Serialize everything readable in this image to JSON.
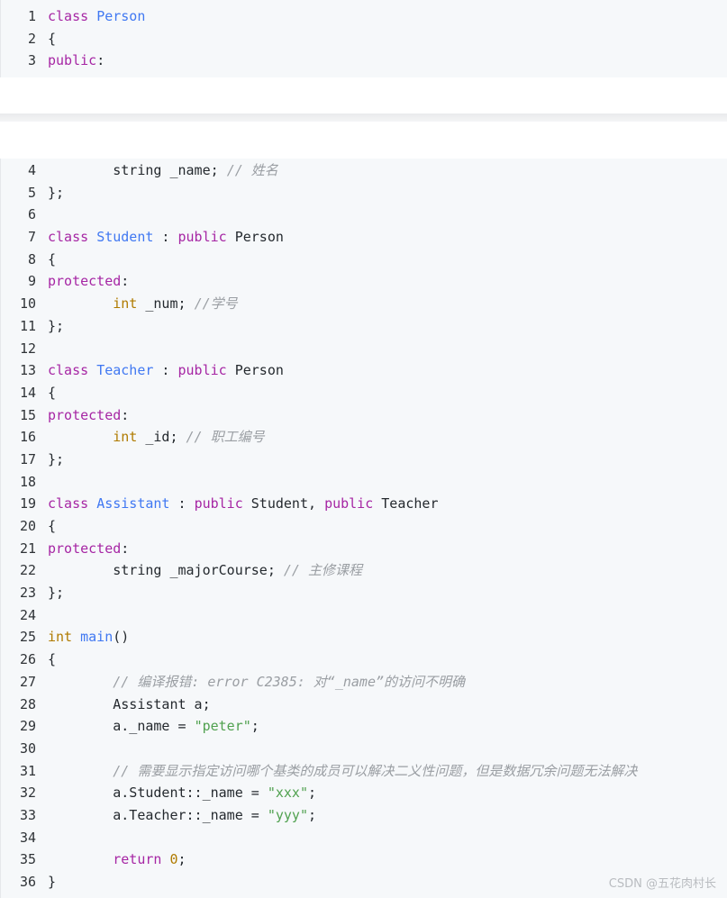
{
  "code_top": [
    {
      "n": "1",
      "tokens": [
        {
          "t": "class",
          "c": "kw"
        },
        {
          "t": " "
        },
        {
          "t": "Person",
          "c": "cls"
        }
      ]
    },
    {
      "n": "2",
      "tokens": [
        {
          "t": "{"
        }
      ]
    },
    {
      "n": "3",
      "tokens": [
        {
          "t": "public",
          "c": "kw"
        },
        {
          "t": ":"
        }
      ]
    }
  ],
  "code_bottom": [
    {
      "n": "4",
      "tokens": [
        {
          "t": "        string _name; "
        },
        {
          "t": "// 姓名",
          "c": "cm"
        }
      ]
    },
    {
      "n": "5",
      "tokens": [
        {
          "t": "};"
        }
      ]
    },
    {
      "n": "6",
      "tokens": []
    },
    {
      "n": "7",
      "tokens": [
        {
          "t": "class",
          "c": "kw"
        },
        {
          "t": " "
        },
        {
          "t": "Student",
          "c": "cls"
        },
        {
          "t": " : "
        },
        {
          "t": "public",
          "c": "kw"
        },
        {
          "t": " Person"
        }
      ]
    },
    {
      "n": "8",
      "tokens": [
        {
          "t": "{"
        }
      ]
    },
    {
      "n": "9",
      "tokens": [
        {
          "t": "protected",
          "c": "kw"
        },
        {
          "t": ":"
        }
      ]
    },
    {
      "n": "10",
      "tokens": [
        {
          "t": "        "
        },
        {
          "t": "int",
          "c": "ty"
        },
        {
          "t": " _num; "
        },
        {
          "t": "//学号",
          "c": "cm"
        }
      ]
    },
    {
      "n": "11",
      "tokens": [
        {
          "t": "};"
        }
      ]
    },
    {
      "n": "12",
      "tokens": []
    },
    {
      "n": "13",
      "tokens": [
        {
          "t": "class",
          "c": "kw"
        },
        {
          "t": " "
        },
        {
          "t": "Teacher",
          "c": "cls"
        },
        {
          "t": " : "
        },
        {
          "t": "public",
          "c": "kw"
        },
        {
          "t": " Person"
        }
      ]
    },
    {
      "n": "14",
      "tokens": [
        {
          "t": "{"
        }
      ]
    },
    {
      "n": "15",
      "tokens": [
        {
          "t": "protected",
          "c": "kw"
        },
        {
          "t": ":"
        }
      ]
    },
    {
      "n": "16",
      "tokens": [
        {
          "t": "        "
        },
        {
          "t": "int",
          "c": "ty"
        },
        {
          "t": " _id; "
        },
        {
          "t": "// 职工编号",
          "c": "cm"
        }
      ]
    },
    {
      "n": "17",
      "tokens": [
        {
          "t": "};"
        }
      ]
    },
    {
      "n": "18",
      "tokens": []
    },
    {
      "n": "19",
      "tokens": [
        {
          "t": "class",
          "c": "kw"
        },
        {
          "t": " "
        },
        {
          "t": "Assistant",
          "c": "cls"
        },
        {
          "t": " : "
        },
        {
          "t": "public",
          "c": "kw"
        },
        {
          "t": " Student, "
        },
        {
          "t": "public",
          "c": "kw"
        },
        {
          "t": " Teacher"
        }
      ]
    },
    {
      "n": "20",
      "tokens": [
        {
          "t": "{"
        }
      ]
    },
    {
      "n": "21",
      "tokens": [
        {
          "t": "protected",
          "c": "kw"
        },
        {
          "t": ":"
        }
      ]
    },
    {
      "n": "22",
      "tokens": [
        {
          "t": "        string _majorCourse; "
        },
        {
          "t": "// 主修课程",
          "c": "cm"
        }
      ]
    },
    {
      "n": "23",
      "tokens": [
        {
          "t": "};"
        }
      ]
    },
    {
      "n": "24",
      "tokens": []
    },
    {
      "n": "25",
      "tokens": [
        {
          "t": "int",
          "c": "ty"
        },
        {
          "t": " "
        },
        {
          "t": "main",
          "c": "cls"
        },
        {
          "t": "()"
        }
      ]
    },
    {
      "n": "26",
      "tokens": [
        {
          "t": "{"
        }
      ]
    },
    {
      "n": "27",
      "tokens": [
        {
          "t": "        "
        },
        {
          "t": "// 编译报错: error C2385: 对“_name”的访问不明确",
          "c": "cm"
        }
      ]
    },
    {
      "n": "28",
      "tokens": [
        {
          "t": "        Assistant a;"
        }
      ]
    },
    {
      "n": "29",
      "tokens": [
        {
          "t": "        a._name = "
        },
        {
          "t": "\"peter\"",
          "c": "str"
        },
        {
          "t": ";"
        }
      ]
    },
    {
      "n": "30",
      "tokens": []
    },
    {
      "n": "31",
      "tokens": [
        {
          "t": "        "
        },
        {
          "t": "// 需要显示指定访问哪个基类的成员可以解决二义性问题，但是数据冗余问题无法解决",
          "c": "cm"
        }
      ]
    },
    {
      "n": "32",
      "tokens": [
        {
          "t": "        a.Student::_name = "
        },
        {
          "t": "\"xxx\"",
          "c": "str"
        },
        {
          "t": ";"
        }
      ]
    },
    {
      "n": "33",
      "tokens": [
        {
          "t": "        a.Teacher::_name = "
        },
        {
          "t": "\"yyy\"",
          "c": "str"
        },
        {
          "t": ";"
        }
      ]
    },
    {
      "n": "34",
      "tokens": []
    },
    {
      "n": "35",
      "tokens": [
        {
          "t": "        "
        },
        {
          "t": "return",
          "c": "kw"
        },
        {
          "t": " "
        },
        {
          "t": "0",
          "c": "num"
        },
        {
          "t": ";"
        }
      ]
    },
    {
      "n": "36",
      "tokens": [
        {
          "t": "}"
        }
      ]
    }
  ],
  "watermark": "CSDN @五花肉村长",
  "colors": {
    "keyword": "#a626a4",
    "type": "#b07b00",
    "class_name": "#4078f2",
    "string": "#50a14f",
    "comment": "#9a9ea3",
    "background": "#f6f8fa"
  }
}
